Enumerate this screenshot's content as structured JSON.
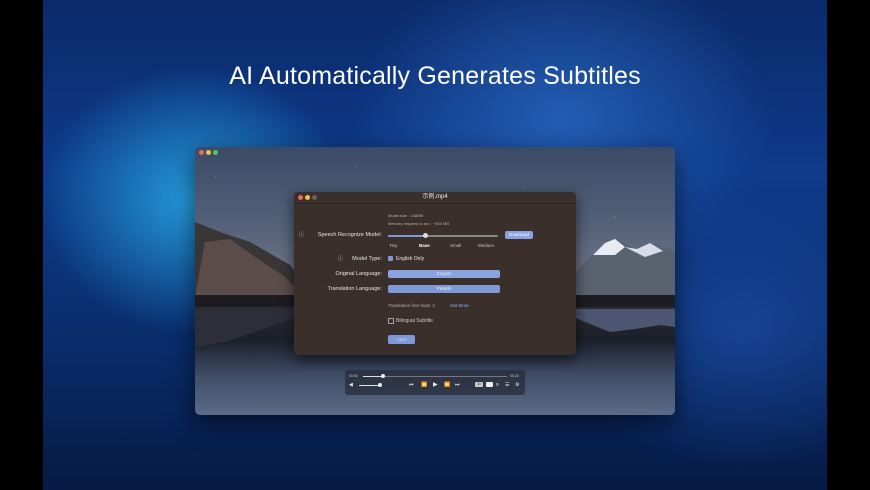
{
  "headline": "AI Automatically Generates Subtitles",
  "colors": {
    "accent": "#7f98d6",
    "dialog_bg": "#3b2f2c"
  },
  "dialog": {
    "title": "示例.mp4",
    "model_size": "Model size : 148MB",
    "memory": "Memory required to run : ~500 MB",
    "speech_label": "Speech Recognize Model:",
    "download": "Download",
    "model_ticks": [
      "Tiny",
      "Base",
      "Small",
      "Medium"
    ],
    "model_type_label": "Model Type:",
    "english_only": "English Only",
    "original_language_label": "Original Language:",
    "original_language_value": "English",
    "translation_language_label": "Translation Language:",
    "translation_language_value": "French",
    "translation_free": "Translation free trials: 2",
    "get_more": "Get More",
    "bilingual": "Bilingual Subtitle",
    "run_button": "Start"
  },
  "player": {
    "time_start": "00:00",
    "time_end": "00:22",
    "badge": "1x",
    "progress": 0.14
  },
  "icons": [
    "volume-icon",
    "previous-icon",
    "rewind-icon",
    "play-icon",
    "forward-icon",
    "next-icon",
    "subtitle-icon",
    "playlist-icon",
    "settings-icon"
  ]
}
